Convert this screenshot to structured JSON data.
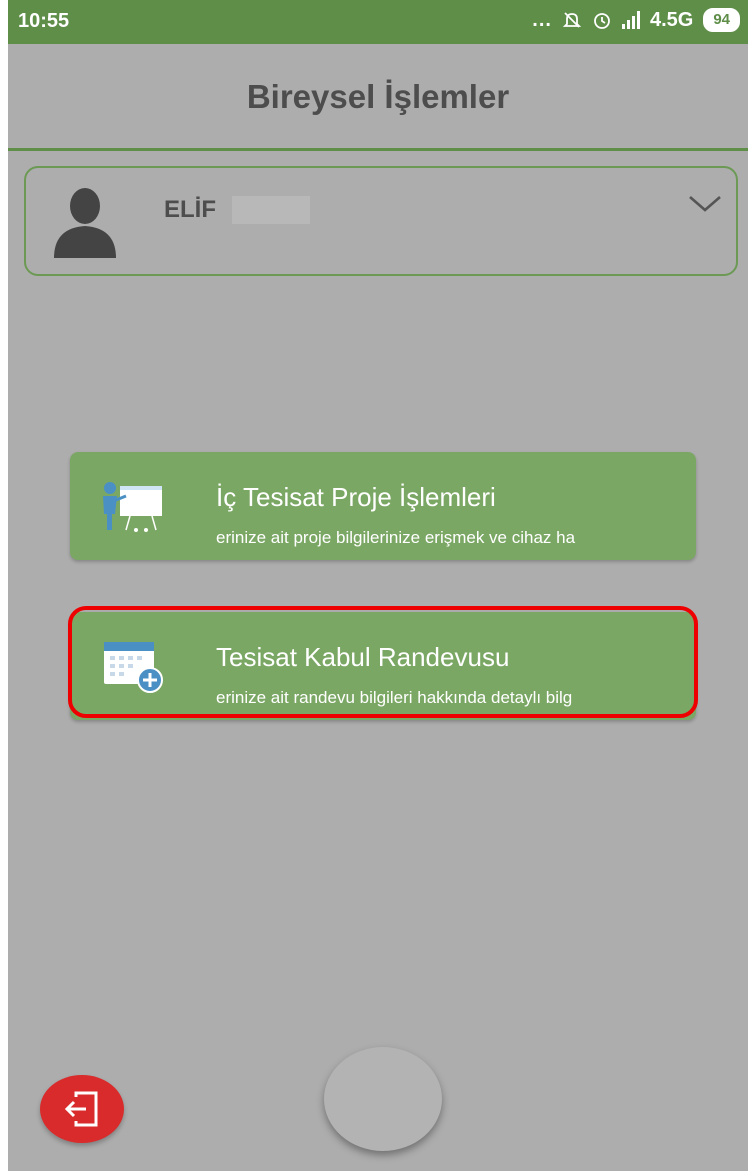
{
  "status_bar": {
    "time": "10:55",
    "dots": "...",
    "network": "4.5G",
    "battery": "94",
    "icons": [
      "mute-icon",
      "alarm-icon",
      "signal-icon",
      "battery-icon"
    ]
  },
  "header": {
    "title": "Bireysel İşlemler"
  },
  "user_card": {
    "name": "ELİF",
    "avatar_icon": "user-avatar-icon",
    "expand_icon": "chevron-down-icon"
  },
  "menu": {
    "items": [
      {
        "title": "İç Tesisat Proje İşlemleri",
        "description": "erinize ait proje bilgilerinize erişmek ve cihaz ha",
        "icon": "presentation-icon"
      },
      {
        "title": "Tesisat Kabul Randevusu",
        "description": "erinize ait randevu bilgileri hakkında detaylı bilg",
        "icon": "calendar-add-icon"
      }
    ]
  },
  "bottom": {
    "exit_icon": "exit-icon",
    "home_icon": "home-button"
  },
  "colors": {
    "primary_green": "#5e8e48",
    "card_green": "#7ba765",
    "overlay_gray": "#adadad",
    "exit_red": "#d92b2b",
    "highlight_red": "#ee0000"
  }
}
